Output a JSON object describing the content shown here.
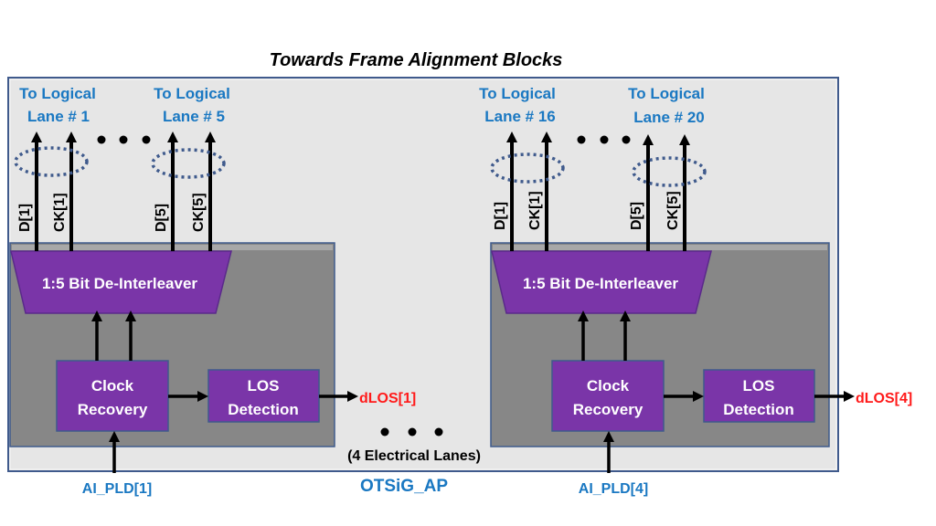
{
  "title": "Towards Frame Alignment Blocks",
  "container_label": "OTSiG_AP",
  "lanes_note": "(4 Electrical Lanes)",
  "colors": {
    "outer_fill": "#e6e6e6",
    "inner_fill": "#878787",
    "block_fill": "#7a35a8",
    "lane_text": "#1a78c2",
    "alarm_text": "#ff1a1a",
    "ellipse": "#3f5a8c"
  },
  "units": [
    {
      "lane_labels": [
        {
          "line1": "To Logical",
          "line2": "Lane # 1"
        },
        {
          "line1": "To Logical",
          "line2": "Lane # 5"
        }
      ],
      "signals": [
        "D[1]",
        "CK[1]",
        "D[5]",
        "CK[5]"
      ],
      "deinterleaver": "1:5 Bit De-Interleaver",
      "clock_recovery": {
        "line1": "Clock",
        "line2": "Recovery"
      },
      "los_detection": {
        "line1": "LOS",
        "line2": "Detection"
      },
      "los_output": "dLOS[1]",
      "input": "AI_PLD[1]"
    },
    {
      "lane_labels": [
        {
          "line1": "To Logical",
          "line2": "Lane # 16"
        },
        {
          "line1": "To Logical",
          "line2": "Lane # 20"
        }
      ],
      "signals": [
        "D[1]",
        "CK[1]",
        "D[5]",
        "CK[5]"
      ],
      "deinterleaver": "1:5 Bit De-Interleaver",
      "clock_recovery": {
        "line1": "Clock",
        "line2": "Recovery"
      },
      "los_detection": {
        "line1": "LOS",
        "line2": "Detection"
      },
      "los_output": "dLOS[4]",
      "input": "AI_PLD[4]"
    }
  ]
}
